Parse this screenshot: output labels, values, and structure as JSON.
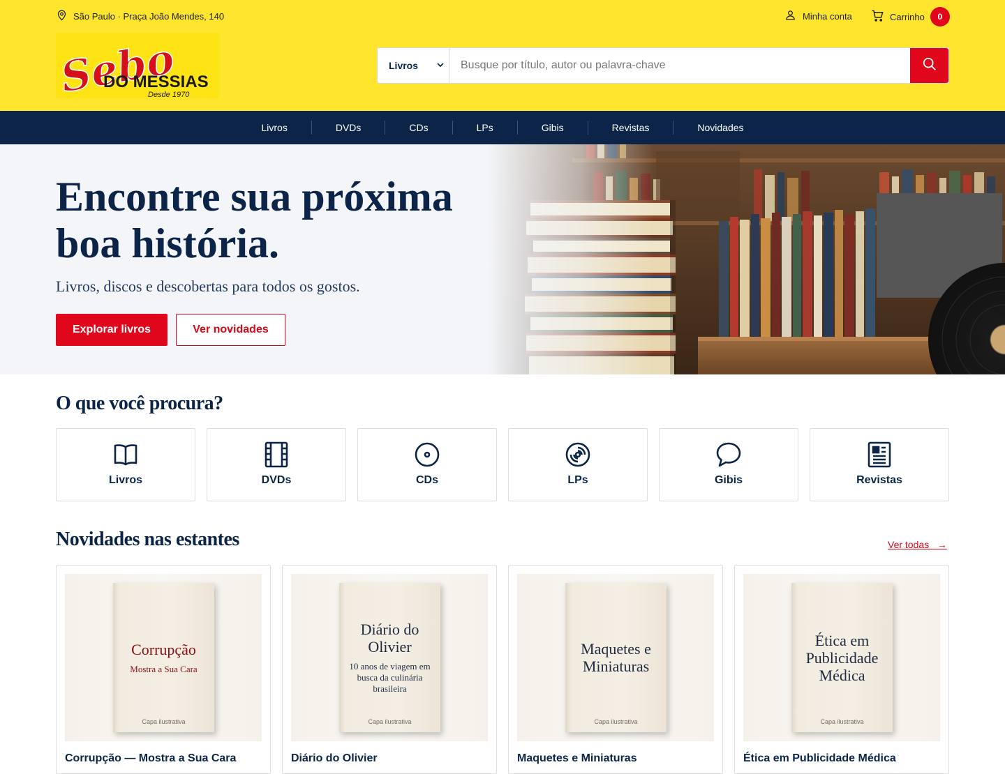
{
  "topbar": {
    "location": "São Paulo · Praça João Mendes, 140",
    "account_label": "Minha conta",
    "cart_label": "Carrinho",
    "cart_count": "0"
  },
  "logo": {
    "line1": "Sebo",
    "line2": "DO MESSIAS",
    "line3": "Desde 1970"
  },
  "search": {
    "category": "Livros",
    "placeholder": "Busque por título, autor ou palavra-chave"
  },
  "nav": [
    "Livros",
    "DVDs",
    "CDs",
    "LPs",
    "Gibis",
    "Revistas",
    "Novidades"
  ],
  "hero": {
    "title": "Encontre sua próxima boa história.",
    "subtitle": "Livros, discos e descobertas para todos os gostos.",
    "primary_button": "Explorar livros",
    "secondary_button": "Ver novidades"
  },
  "categories": {
    "title": "O que você procura?",
    "items": [
      {
        "label": "Livros",
        "icon": "book-icon"
      },
      {
        "label": "DVDs",
        "icon": "film-icon"
      },
      {
        "label": "CDs",
        "icon": "cd-icon"
      },
      {
        "label": "LPs",
        "icon": "vinyl-icon"
      },
      {
        "label": "Gibis",
        "icon": "speech-bubble-icon"
      },
      {
        "label": "Revistas",
        "icon": "newspaper-icon"
      }
    ]
  },
  "new_arrivals": {
    "title": "Novidades nas estantes",
    "see_all": "Ver todas   →",
    "cover_caption": "Capa ilustrativa",
    "products": [
      {
        "cover_title": "Corrupção",
        "cover_subtitle": "Mostra a Sua Cara",
        "name": "Corrupção — Mostra a Sua Cara"
      },
      {
        "cover_title": "Diário do Olivier",
        "cover_subtitle": "10 anos de viagem em busca da culinária brasileira",
        "name": "Diário do Olivier"
      },
      {
        "cover_title": "Maquetes e Miniaturas",
        "cover_subtitle": "",
        "name": "Maquetes e Miniaturas"
      },
      {
        "cover_title": "Ética em Publicidade Médica",
        "cover_subtitle": "",
        "name": "Ética em Publicidade Médica"
      }
    ]
  },
  "colors": {
    "header_yellow": "#ffe52e",
    "brand_red": "#e0071c",
    "navy": "#0b2447"
  }
}
